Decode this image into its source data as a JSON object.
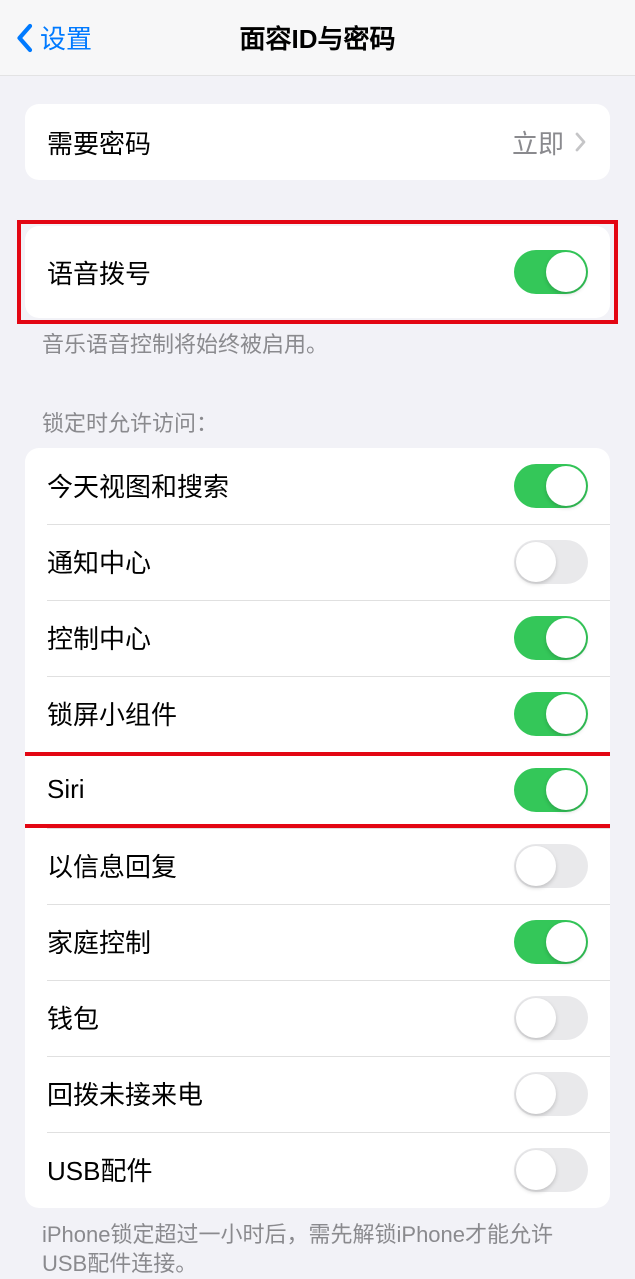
{
  "nav": {
    "back_label": "设置",
    "title": "面容ID与密码"
  },
  "require_passcode": {
    "label": "需要密码",
    "value": "立即"
  },
  "voice_dial": {
    "label": "语音拨号",
    "footer": "音乐语音控制将始终被启用。",
    "on": true
  },
  "locked_header": "锁定时允许访问：",
  "locked_items": [
    {
      "label": "今天视图和搜索",
      "on": true
    },
    {
      "label": "通知中心",
      "on": false
    },
    {
      "label": "控制中心",
      "on": true
    },
    {
      "label": "锁屏小组件",
      "on": true
    },
    {
      "label": "Siri",
      "on": true,
      "highlighted": true
    },
    {
      "label": "以信息回复",
      "on": false
    },
    {
      "label": "家庭控制",
      "on": true
    },
    {
      "label": "钱包",
      "on": false
    },
    {
      "label": "回拨未接来电",
      "on": false
    },
    {
      "label": "USB配件",
      "on": false
    }
  ],
  "usb_footer": "iPhone锁定超过一小时后，需先解锁iPhone才能允许USB配件连接。"
}
